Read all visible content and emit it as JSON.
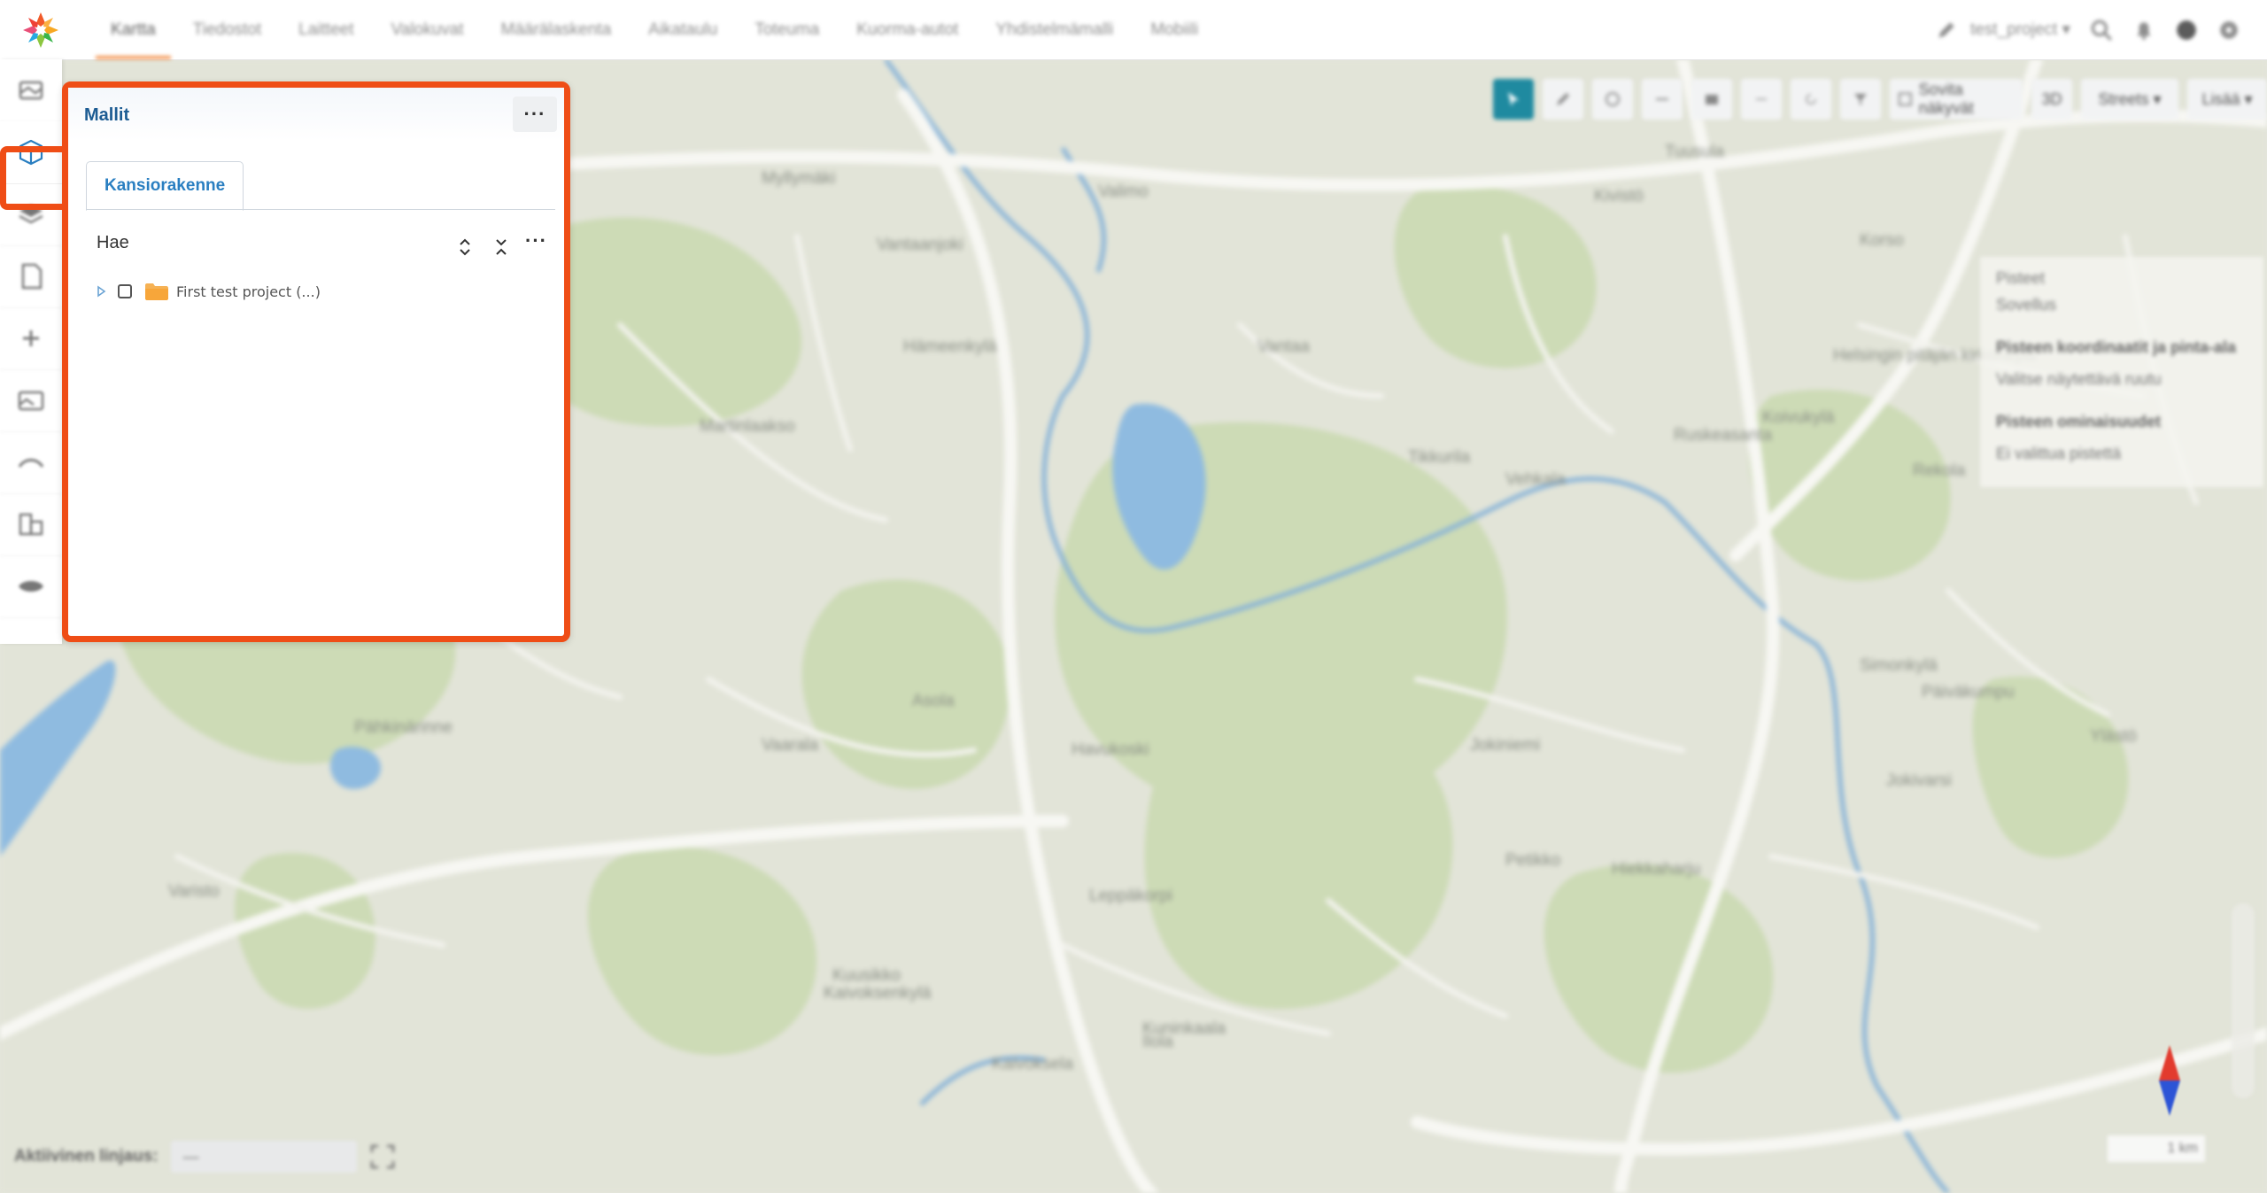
{
  "app": {
    "name": "Infrakit"
  },
  "nav": {
    "items": [
      "Kartta",
      "Tiedostot",
      "Laitteet",
      "Valokuvat",
      "Määrälaskenta",
      "Aikataulu",
      "Toteuma",
      "Kuorma-autot",
      "Yhdistelmämalli",
      "Mobiili"
    ],
    "active_index": 0
  },
  "user": {
    "project": "test_project ▾"
  },
  "rail": {
    "items": [
      "map-layers",
      "models",
      "layers",
      "documents",
      "points",
      "photos",
      "cross-section",
      "quantities",
      "surface"
    ],
    "active_index": 1
  },
  "panel": {
    "title": "Mallit",
    "menu_label": "···",
    "tab_label": "Kansiorakenne",
    "search_label": "Hae",
    "search_menu": "···",
    "tree": [
      {
        "label": "First test project (...)",
        "checked": false,
        "expanded": false
      }
    ]
  },
  "map_toolbar": {
    "buttons": [
      "select",
      "draw",
      "measure",
      "line",
      "area",
      "minus",
      "rotate",
      "filter"
    ],
    "fit_label": "Sovita näkyvät",
    "mode_3d": "3D",
    "basemap": "Streets ▾",
    "more": "Lisää ▾"
  },
  "legend": {
    "title": "Pisteet",
    "subtitle": "Sovellus",
    "item1": "Pisteen koordinaatit ja pinta-ala",
    "item1_sub": "Valitse näytettävä ruutu",
    "item2": "Pisteen ominaisuudet",
    "item2_sub": "Ei valittua pistettä"
  },
  "bottom": {
    "active_label": "Aktiivinen linjaus:",
    "active_value": "—"
  },
  "scale": {
    "label": "1 km"
  },
  "map": {
    "places": [
      "Myllymäki",
      "Tuusula",
      "Vantaanjoki",
      "Valimo",
      "Vantaa",
      "Martinlaakso",
      "Hämeenkylä",
      "Kivistö",
      "Tikkurila",
      "Koivukylä",
      "Rekola",
      "Korso",
      "Ruskeasanta",
      "Hiekkaharju",
      "Jokiniemi",
      "Havukoski",
      "Simonkylä",
      "Asola",
      "Leppäkorpi",
      "Kuusikko",
      "Päiväkumpu",
      "Kaivoksela",
      "Vaarala",
      "Kuninkaala",
      "Vehkala",
      "Pähkinärinne",
      "Petikko",
      "Varisto",
      "Ylästö",
      "Ilola",
      "Jokivarsi",
      "Kaivoksenkylä",
      "Helsingin pitäjän kirkonkylä"
    ]
  }
}
